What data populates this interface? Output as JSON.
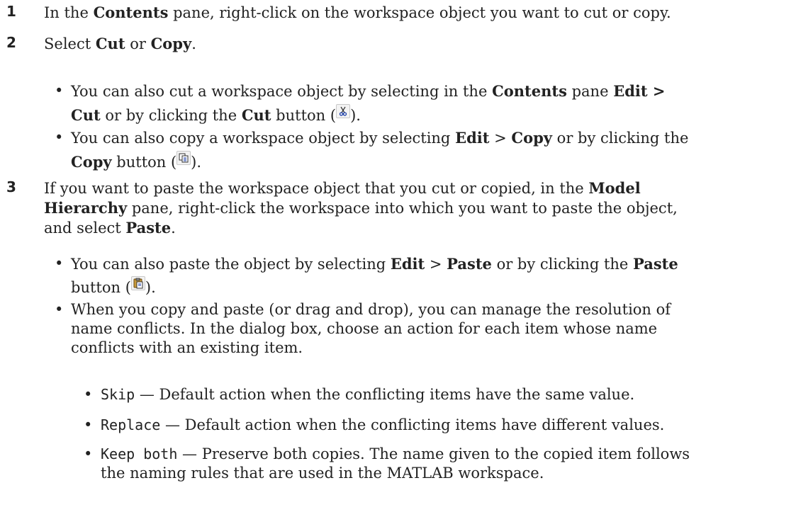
{
  "step1": {
    "number": "1",
    "p1": "In the ",
    "b1": "Contents",
    "p2": " pane, right-click on the workspace object you want to cut or copy."
  },
  "step2": {
    "number": "2",
    "p1": "Select ",
    "b1": "Cut",
    "p2": " or ",
    "b2": "Copy",
    "p3": ".",
    "bullet1": {
      "p1": "You can also cut a workspace object by selecting in the ",
      "b1": "Contents",
      "p2": " pane ",
      "b2": "Edit >",
      "b3": "Cut",
      "p3": " or by clicking the ",
      "b4": "Cut",
      "p4": " button (",
      "p5": ")."
    },
    "bullet2": {
      "p1": "You can also copy a workspace object by selecting ",
      "b1": "Edit",
      "p2": " > ",
      "b2": "Copy",
      "p3": " or by clicking the",
      "b3": "Copy",
      "p4": " button (",
      "p5": ")."
    }
  },
  "step3": {
    "number": "3",
    "p1": "If you want to paste the workspace object that you cut or copied, in the ",
    "b1": "Model",
    "b2": "Hierarchy",
    "p2": " pane, right-click the workspace into which you want to paste the object,",
    "p3": "and select ",
    "b3": "Paste",
    "p4": ".",
    "bullet1": {
      "p1": "You can also paste the object by selecting ",
      "b1": "Edit",
      "p2": " > ",
      "b2": "Paste",
      "p3": " or by clicking the ",
      "b3": "Paste",
      "p4": "button (",
      "p5": ")."
    },
    "bullet2": {
      "l1": "When you copy and paste (or drag and drop), you can manage the resolution of",
      "l2": "name conflicts. In the dialog box, choose an action for each item whose name",
      "l3": "conflicts with an existing item."
    },
    "options": [
      {
        "code": "Skip",
        "desc": " — Default action when the conflicting items have the same value."
      },
      {
        "code": "Replace",
        "desc": " — Default action when the conflicting items have different values."
      },
      {
        "code": "Keep both",
        "desc": " — Preserve both copies. The name given to the copied item follows",
        "desc2": "the naming rules that are used in the MATLAB workspace."
      }
    ]
  },
  "icons": [
    "scissors-icon",
    "copy-icon",
    "paste-icon"
  ]
}
